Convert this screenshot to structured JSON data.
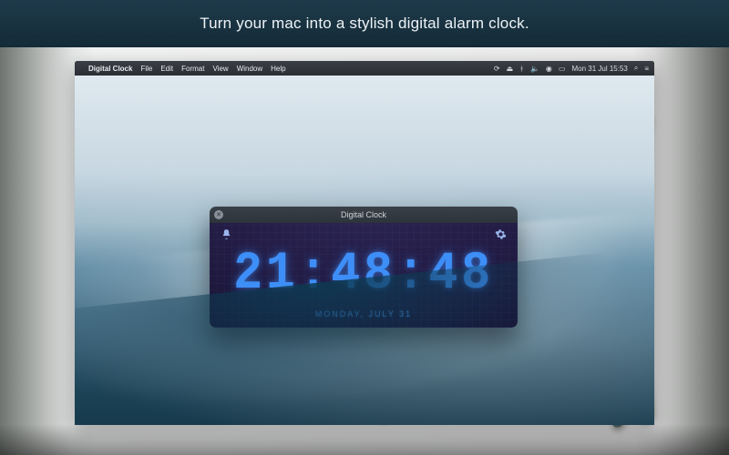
{
  "promo": {
    "tagline": "Turn your mac into a stylish digital alarm clock."
  },
  "menubar": {
    "apple": "",
    "app_name": "Digital Clock",
    "items": [
      "File",
      "Edit",
      "Format",
      "View",
      "Window",
      "Help"
    ],
    "status": {
      "icons": [
        "sync-icon",
        "eject-icon",
        "bluetooth-icon",
        "volume-icon",
        "wifi-icon",
        "battery-icon"
      ],
      "datetime": "Mon 31 Jul  15:53",
      "right_icons": [
        "search-icon",
        "notifications-icon"
      ]
    }
  },
  "clock_window": {
    "title": "Digital Clock",
    "close_label": "✕",
    "alarm_icon": "bell-icon",
    "settings_icon": "gear-icon",
    "time": "21:48:48",
    "date": "MONDAY, JULY 31"
  },
  "decoration": {
    "note_glyph": "🎵"
  },
  "colors": {
    "promo_band": "#17303f",
    "clock_digits": "#3e8ef7",
    "clock_panel": "#1f1a3e",
    "note": "#f5c531"
  }
}
